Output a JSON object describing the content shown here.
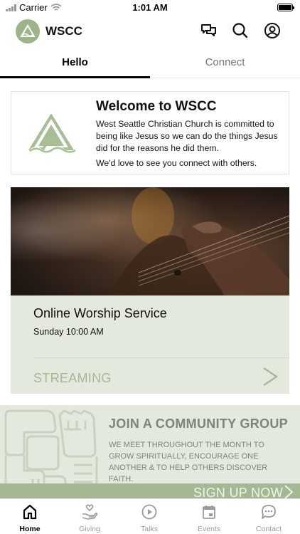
{
  "status_bar": {
    "carrier": "Carrier",
    "time": "1:01 AM"
  },
  "header": {
    "title": "WSCC"
  },
  "tabs": [
    {
      "label": "Hello"
    },
    {
      "label": "Connect"
    }
  ],
  "welcome": {
    "title": "Welcome to WSCC",
    "body": "West Seattle Christian Church is committed to being like Jesus so we can do the things Jesus did for the reasons he did them.",
    "subtext": "We'd love to see you connect with others."
  },
  "worship": {
    "title": "Online Worship Service",
    "time": "Sunday 10:00 AM",
    "action": "STREAMING"
  },
  "community": {
    "title": "JOIN A COMMUNITY GROUP",
    "body": "WE MEET THROUGHOUT THE MONTH TO GROW SPIRITUALLY, ENCOURAGE ONE ANOTHER & TO HELP OTHERS DISCOVER FAITH.",
    "cta": "SIGN UP NOW"
  },
  "bottom_nav": [
    {
      "label": "Home",
      "icon": "home-icon"
    },
    {
      "label": "Giving",
      "icon": "giving-icon"
    },
    {
      "label": "Talks",
      "icon": "play-icon"
    },
    {
      "label": "Events",
      "icon": "calendar-icon"
    },
    {
      "label": "Contact",
      "icon": "chat-icon"
    }
  ],
  "colors": {
    "brand_green": "#9db38a",
    "card_bg": "#e3eadd",
    "muted_text": "#7c8576"
  }
}
